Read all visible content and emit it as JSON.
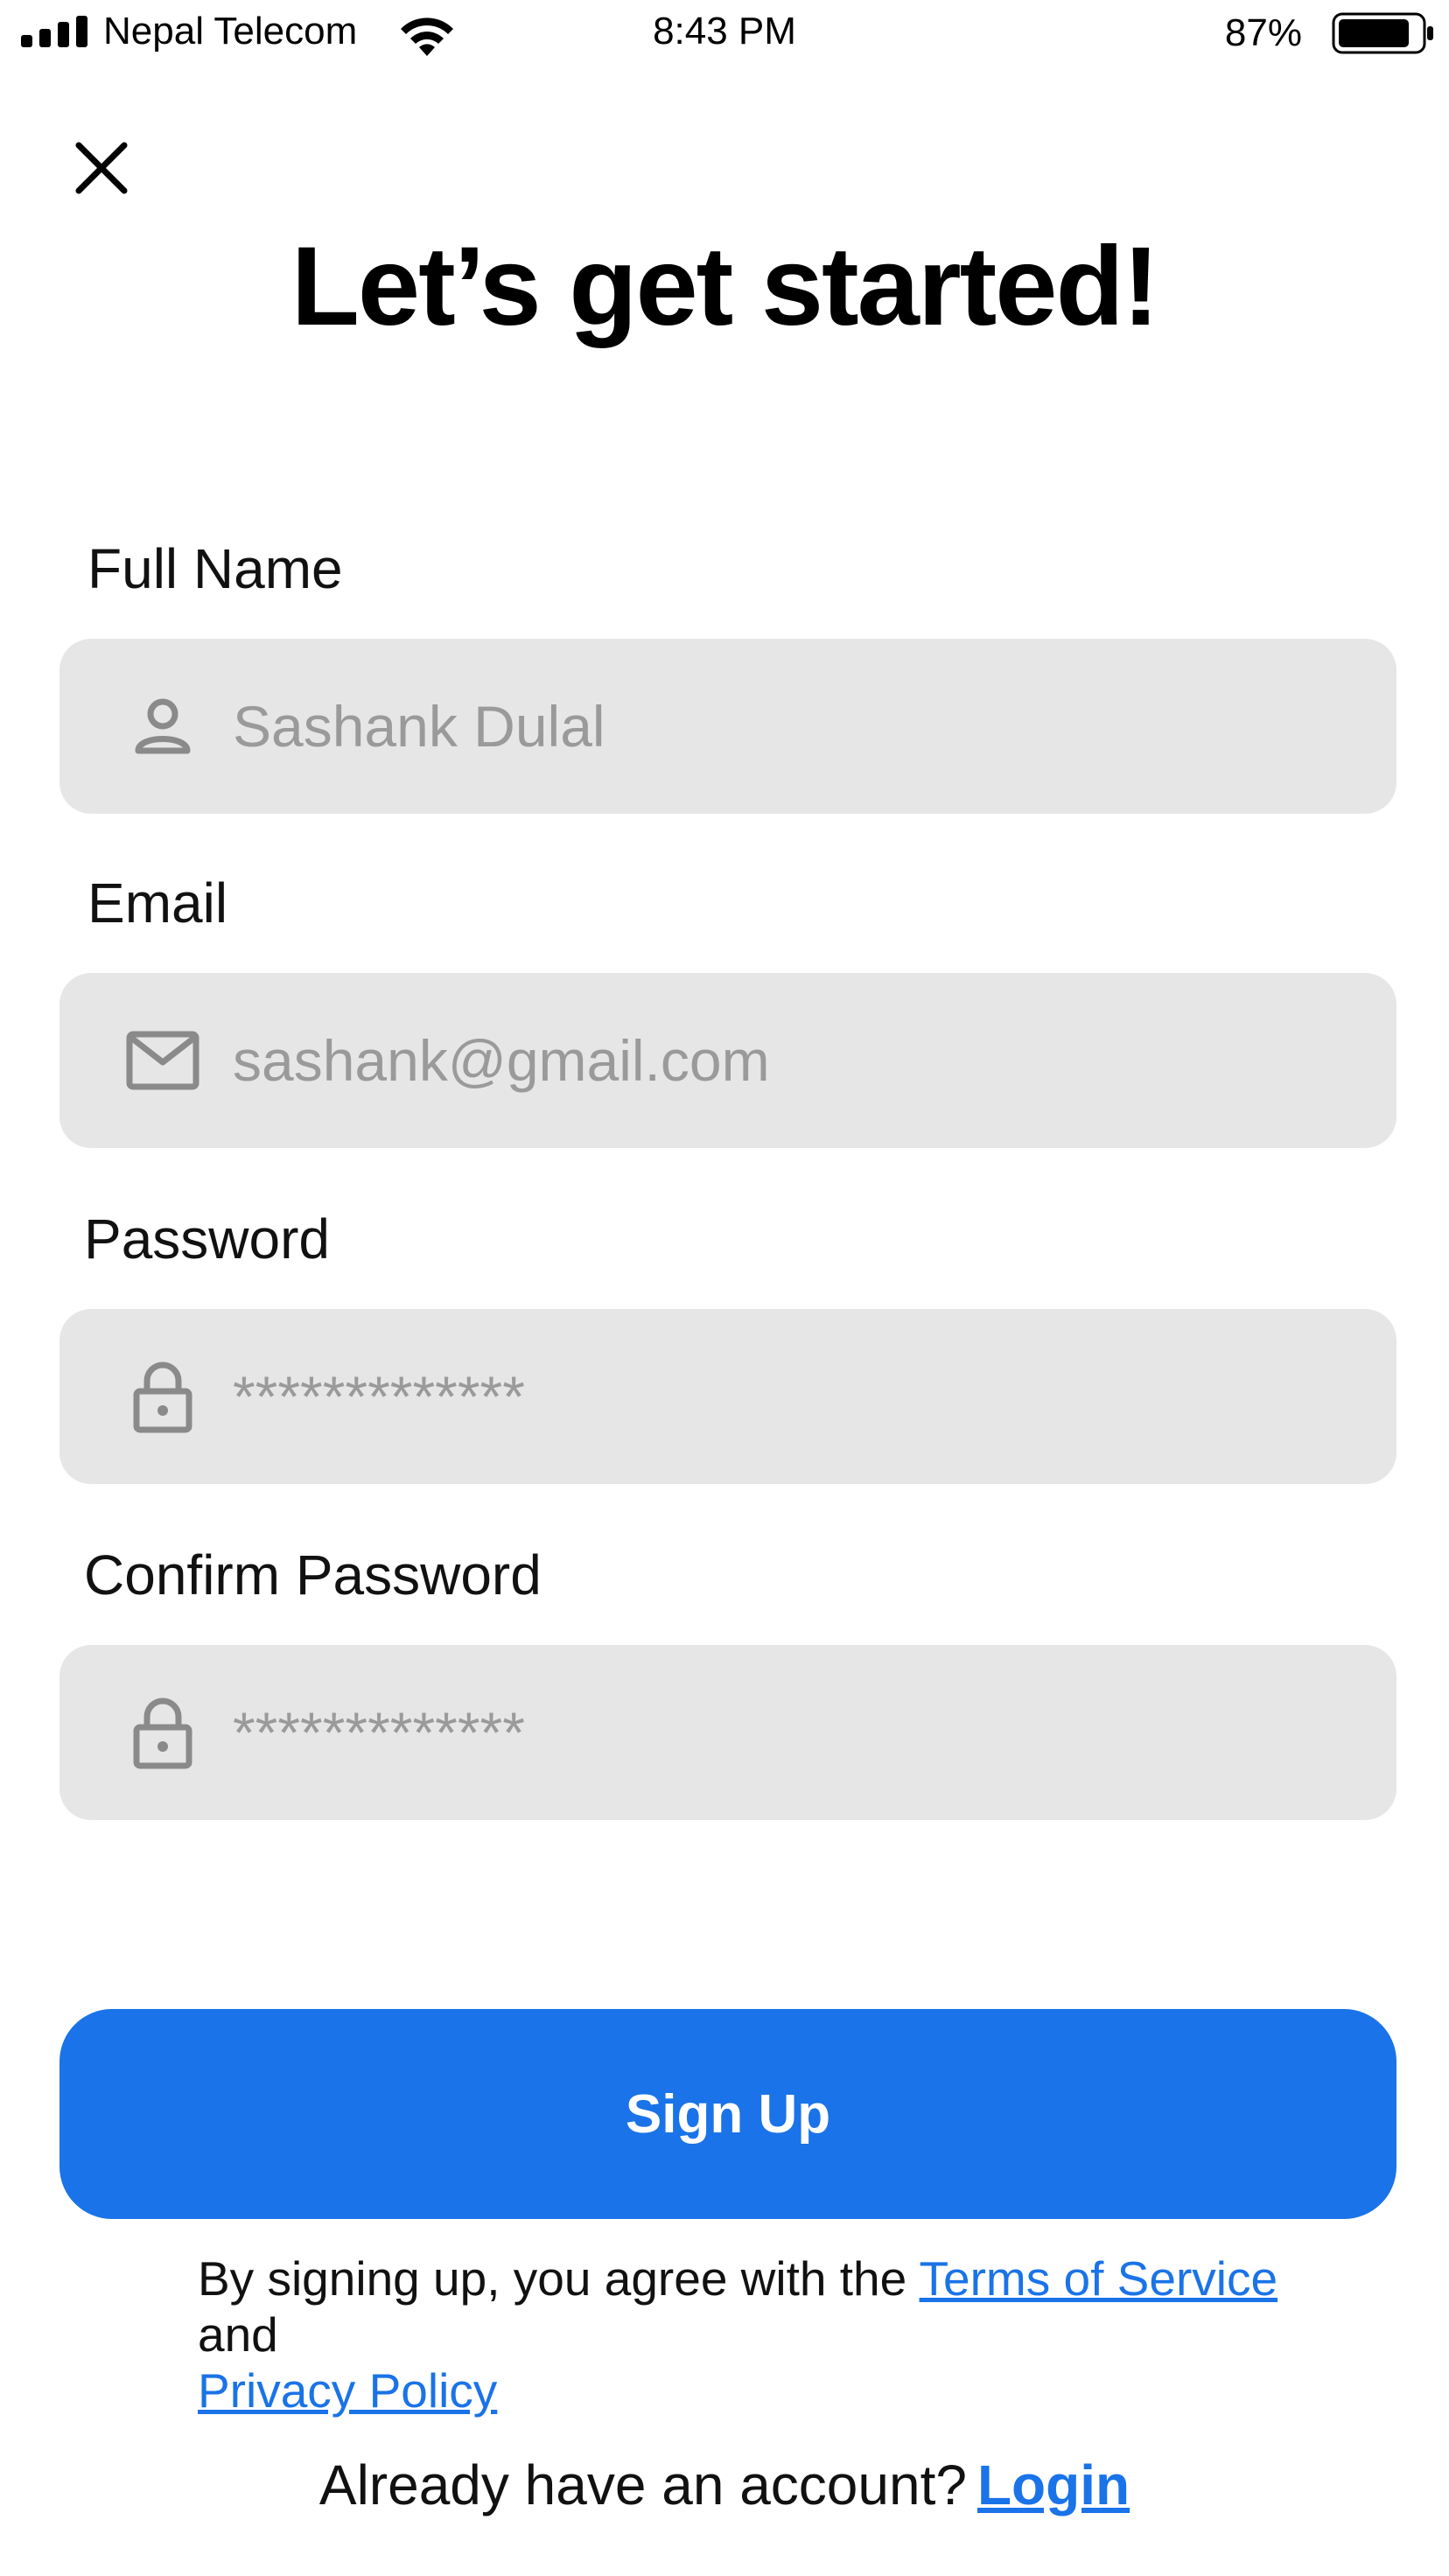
{
  "status_bar": {
    "carrier": "Nepal Telecom",
    "time": "8:43 PM",
    "battery_percent": "87%",
    "signal_icon": "signal-bars-icon",
    "wifi_icon": "wifi-icon",
    "battery_icon": "battery-icon",
    "battery_level": 0.87
  },
  "header": {
    "close_icon": "close-icon",
    "title": "Let’s get started!"
  },
  "form": {
    "full_name": {
      "label": "Full Name",
      "placeholder": "Sashank Dulal",
      "value": "",
      "icon": "person-icon"
    },
    "email": {
      "label": "Email",
      "placeholder": "sashank@gmail.com",
      "value": "",
      "icon": "mail-icon"
    },
    "password": {
      "label": "Password",
      "placeholder": "*************",
      "value": "",
      "icon": "lock-icon"
    },
    "confirm_password": {
      "label": "Confirm Password",
      "placeholder": "*************",
      "value": "",
      "icon": "lock-icon"
    }
  },
  "actions": {
    "signup_label": "Sign Up"
  },
  "terms": {
    "prefix": "By signing up, you agree with the",
    "terms_link": "Terms of Service",
    "conjunction": "and",
    "privacy_link": "Privacy Policy"
  },
  "login": {
    "prompt": "Already have an account?",
    "link": "Login"
  },
  "colors": {
    "accent": "#1a73e8",
    "field_background": "#e6e6e6",
    "placeholder_text": "#9a9a9a",
    "icon": "#8a8a8a"
  }
}
